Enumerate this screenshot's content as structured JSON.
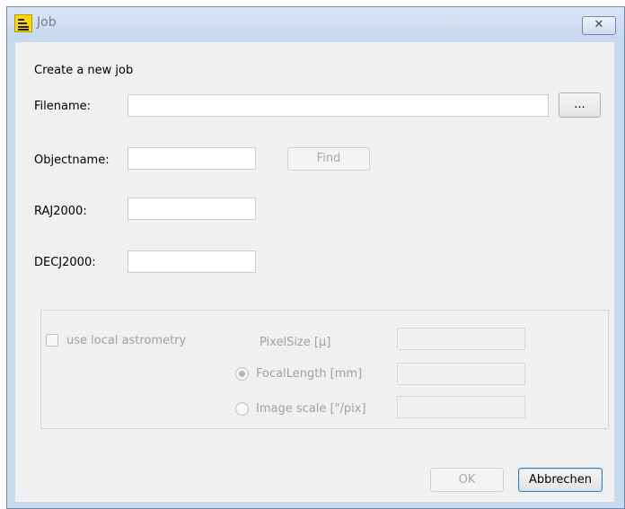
{
  "window": {
    "title": "Job",
    "close_glyph": "✕"
  },
  "form": {
    "heading": "Create a new job",
    "filename_label": "Filename:",
    "filename_value": "",
    "browse_label": "...",
    "objectname_label": "Objectname:",
    "objectname_value": "",
    "find_label": "Find",
    "ra_label": "RAJ2000:",
    "ra_value": "",
    "dec_label": "DECJ2000:",
    "dec_value": ""
  },
  "astrometry": {
    "use_local_label": "use local astrometry",
    "use_local_checked": false,
    "pixelsize_label": "PixelSize [µ]",
    "pixelsize_value": "",
    "focal_label": "FocalLength [mm]",
    "focal_selected": true,
    "focal_value": "",
    "imagescale_label": "Image scale [\"/pix]",
    "imagescale_selected": false,
    "imagescale_value": ""
  },
  "footer": {
    "ok_label": "OK",
    "cancel_label": "Abbrechen"
  },
  "icons": {
    "app": "job-app-icon",
    "close": "close-icon"
  },
  "colors": {
    "titlebar": "#c9d9ee",
    "client": "#f0f0f0",
    "disabled_text": "#a0a0a0",
    "default_button_border": "#3c7fb1"
  }
}
